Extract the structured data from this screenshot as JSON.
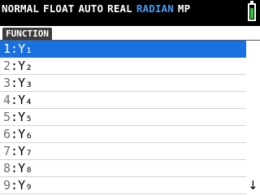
{
  "status_bar": {
    "modes": [
      {
        "text": "NORMAL",
        "active": false
      },
      {
        "text": "FLOAT",
        "active": false
      },
      {
        "text": "AUTO",
        "active": false
      },
      {
        "text": "REAL",
        "active": false
      },
      {
        "text": "RADIAN",
        "active": true
      },
      {
        "text": "MP",
        "active": false
      }
    ],
    "active_mode_color": "#4a9cf0",
    "battery_color": "#2fc23a",
    "battery_level": 0.7
  },
  "tab": {
    "label": "FUNCTION"
  },
  "menu": {
    "selected_index": 0,
    "selection_color": "#1971e0",
    "separator": ":",
    "items": [
      {
        "number": "1",
        "label": "Y₁"
      },
      {
        "number": "2",
        "label": "Y₂"
      },
      {
        "number": "3",
        "label": "Y₃"
      },
      {
        "number": "4",
        "label": "Y₄"
      },
      {
        "number": "5",
        "label": "Y₅"
      },
      {
        "number": "6",
        "label": "Y₆"
      },
      {
        "number": "7",
        "label": "Y₇"
      },
      {
        "number": "8",
        "label": "Y₈"
      },
      {
        "number": "9",
        "label": "Y₉"
      }
    ]
  },
  "scroll_indicator": {
    "icon": "arrow-down-icon",
    "glyph": "↓"
  }
}
